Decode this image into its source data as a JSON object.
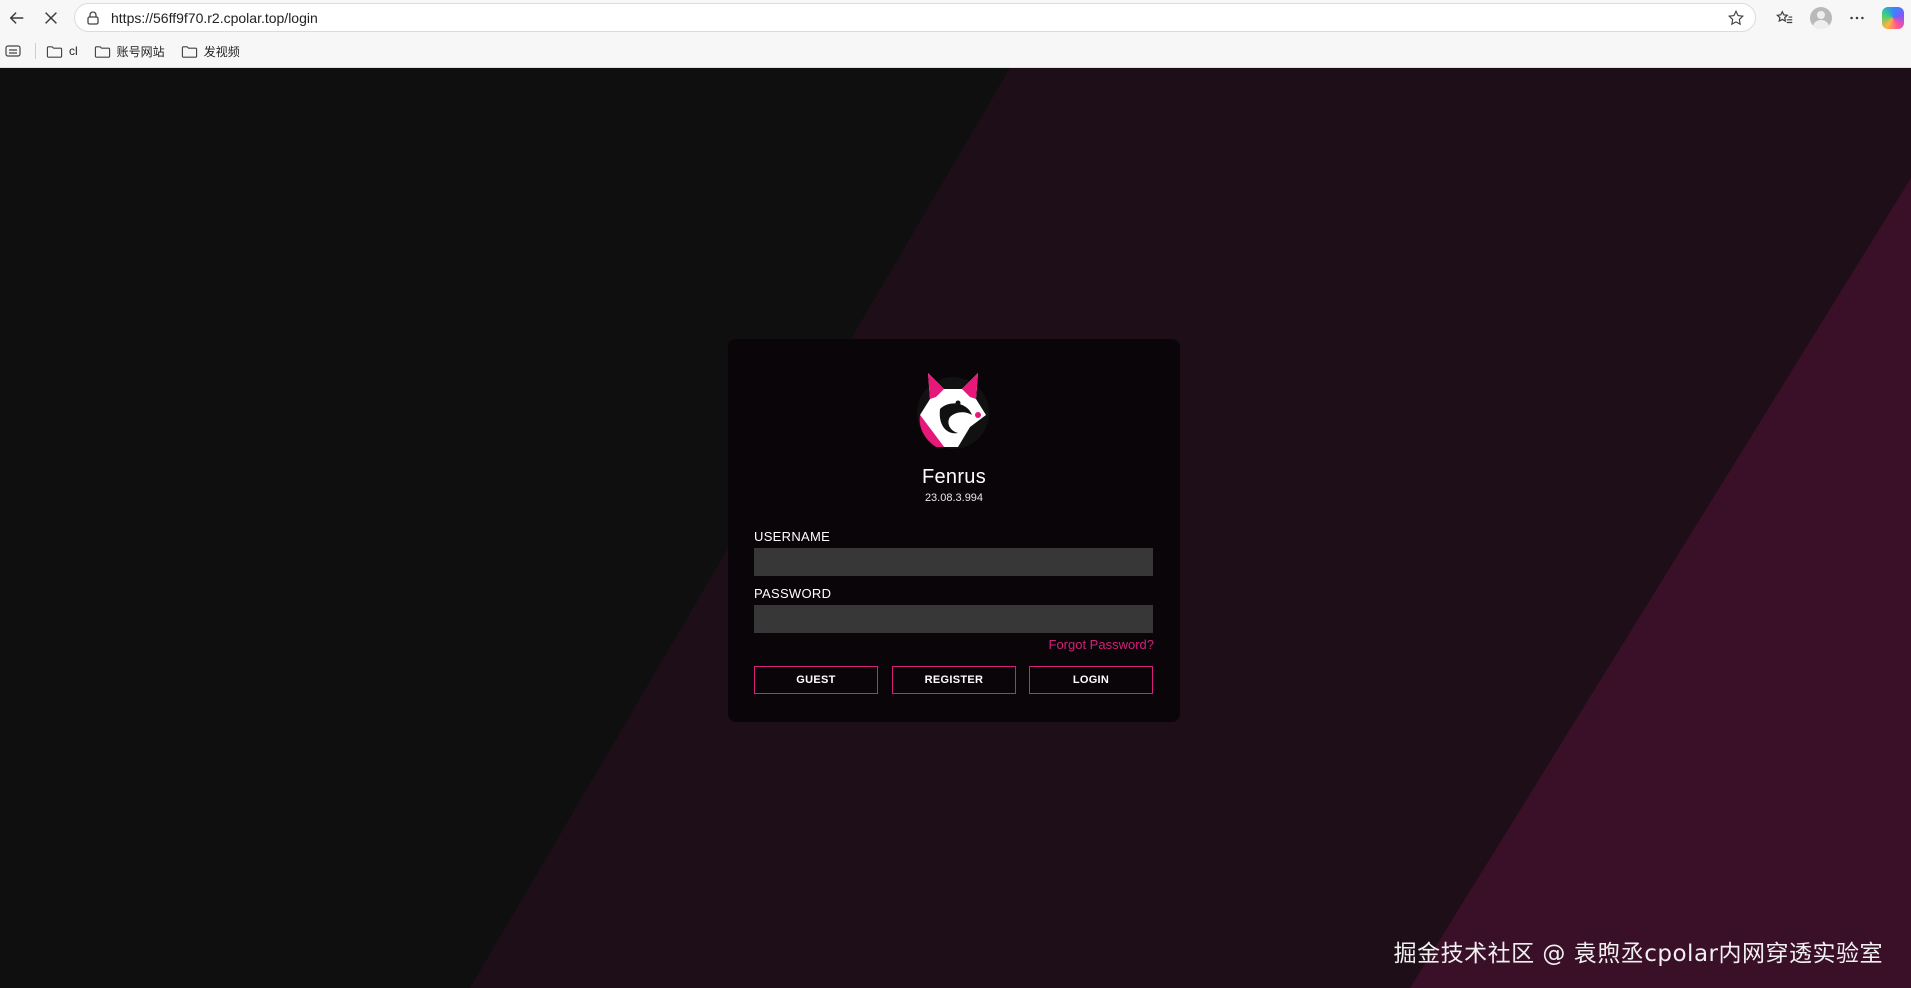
{
  "browser": {
    "url": "https://56ff9f70.r2.cpolar.top/login",
    "bookmarks": [
      {
        "label": "cl"
      },
      {
        "label": "账号网站"
      },
      {
        "label": "发视频"
      }
    ]
  },
  "login": {
    "app_name": "Fenrus",
    "version": "23.08.3.994",
    "username_label": "USERNAME",
    "username_value": "",
    "password_label": "PASSWORD",
    "password_value": "",
    "forgot_password": "Forgot Password?",
    "buttons": {
      "guest": "GUEST",
      "register": "REGISTER",
      "login": "LOGIN"
    }
  },
  "theme": {
    "accent": "#d61f7c",
    "card_bg": "#0a0508",
    "input_bg": "#373737"
  },
  "watermark": "掘金技术社区 @ 袁煦丞cpolar内网穿透实验室"
}
